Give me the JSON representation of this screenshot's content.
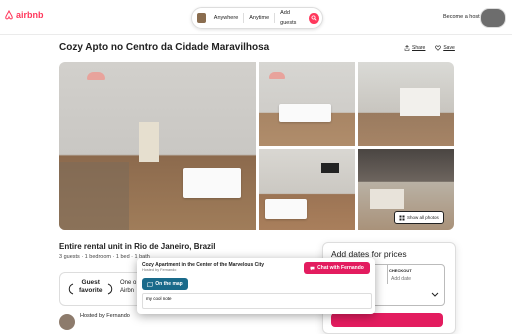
{
  "header": {
    "logo": "airbnb",
    "search_segments": [
      "Anywhere",
      "Anytime",
      "Add guests"
    ],
    "host_link": "Become a host"
  },
  "listing": {
    "title": "Cozy Apto no Centro da Cidade Maravilhosa",
    "share": "Share",
    "save": "Save",
    "show_all_photos": "Show all photos",
    "subtitle": "Entire rental unit in Rio de Janeiro, Brazil",
    "details": "3 guests · 1 bedroom · 1 bed · 1 bath",
    "guest_favorite": [
      "Guest",
      "favorite"
    ],
    "guest_favorite_desc": [
      "One o",
      "Airbn"
    ],
    "hosted_by": "Hosted by Fernando"
  },
  "booking": {
    "title": "Add dates for prices",
    "checkout_label": "CHECKOUT",
    "checkout_placeholder": "Add date"
  },
  "popup": {
    "title": "Cozy Apartment in the Center of the Marvelous City",
    "subtitle": "Hosted by Fernando",
    "chat_button": "Chat with Fernando",
    "map_button": "On the map",
    "note_value": "my cool note"
  },
  "colors": {
    "brand": "#ff385c",
    "map_button": "#1a6a8a"
  }
}
